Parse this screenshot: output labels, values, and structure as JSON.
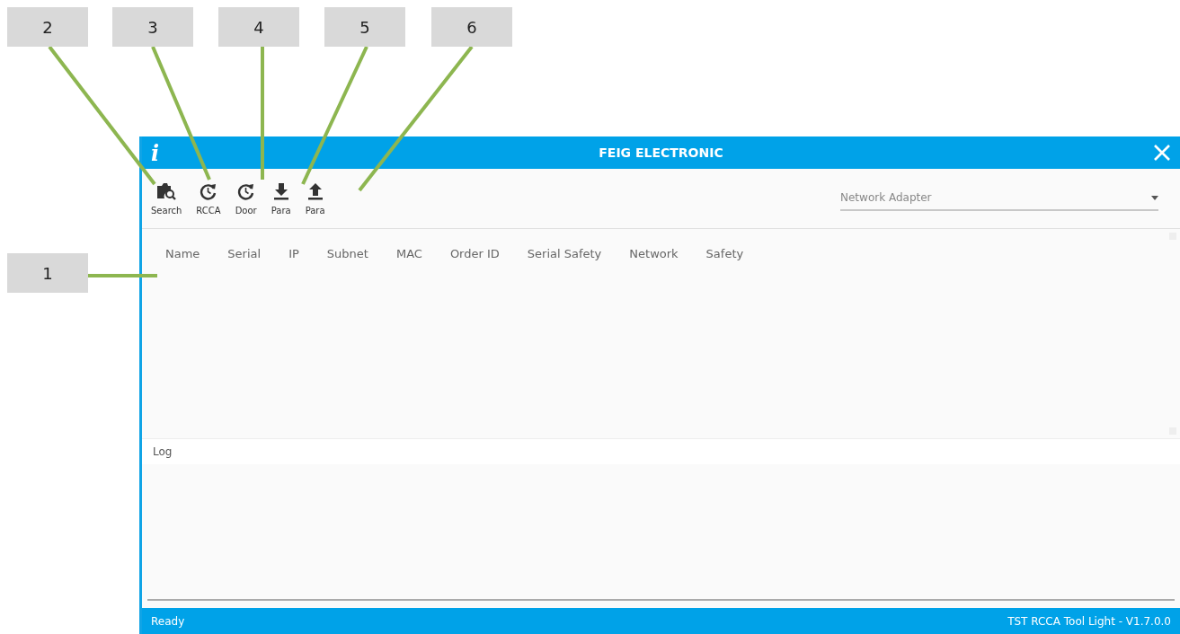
{
  "callouts": [
    {
      "label": "2"
    },
    {
      "label": "3"
    },
    {
      "label": "4"
    },
    {
      "label": "5"
    },
    {
      "label": "6"
    },
    {
      "label": "1"
    }
  ],
  "window": {
    "info_glyph": "i",
    "title": "FEIG ELECTRONIC"
  },
  "toolbar": [
    {
      "label": "Search",
      "kind": "search"
    },
    {
      "label": "RCCA",
      "kind": "history"
    },
    {
      "label": "Door",
      "kind": "history"
    },
    {
      "label": "Para",
      "kind": "download"
    },
    {
      "label": "Para",
      "kind": "upload"
    }
  ],
  "network_adapter": {
    "placeholder": "Network Adapter"
  },
  "table": {
    "columns": [
      "Name",
      "Serial",
      "IP",
      "Subnet",
      "MAC",
      "Order ID",
      "Serial Safety",
      "Network",
      "Safety"
    ]
  },
  "log": {
    "label": "Log"
  },
  "status_bar": {
    "left": "Ready",
    "right": "TST RCCA Tool Light - V1.7.0.0"
  }
}
